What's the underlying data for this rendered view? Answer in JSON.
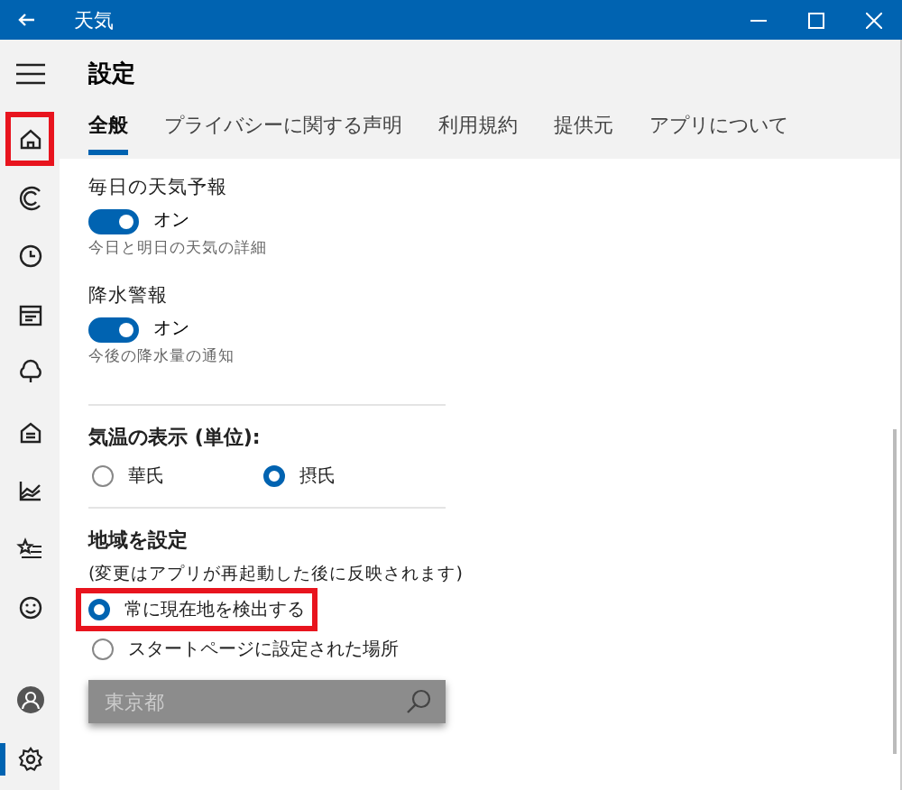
{
  "window": {
    "title": "天気"
  },
  "sidebar": {
    "items": [
      {
        "kind": "home",
        "selected": false,
        "highlighted": true
      },
      {
        "kind": "forecast",
        "selected": false,
        "highlighted": false
      },
      {
        "kind": "clock",
        "selected": false,
        "highlighted": false
      },
      {
        "kind": "calendar",
        "selected": false,
        "highlighted": false
      },
      {
        "kind": "cloud",
        "selected": false,
        "highlighted": false
      },
      {
        "kind": "building",
        "selected": false,
        "highlighted": false
      },
      {
        "kind": "chart",
        "selected": false,
        "highlighted": false
      },
      {
        "kind": "favorites",
        "selected": false,
        "highlighted": false
      },
      {
        "kind": "smile",
        "selected": false,
        "highlighted": false
      }
    ],
    "bottom_items": [
      {
        "kind": "account",
        "selected": false
      },
      {
        "kind": "settings",
        "selected": true
      }
    ]
  },
  "header": {
    "title": "設定"
  },
  "tabs": [
    {
      "label": "全般",
      "selected": true
    },
    {
      "label": "プライバシーに関する声明",
      "selected": false
    },
    {
      "label": "利用規約",
      "selected": false
    },
    {
      "label": "提供元",
      "selected": false
    },
    {
      "label": "アプリについて",
      "selected": false
    }
  ],
  "toggles": [
    {
      "label": "毎日の天気予報",
      "on": true,
      "state_text": "オン",
      "caption": "今日と明日の天気の詳細"
    },
    {
      "label": "降水警報",
      "on": true,
      "state_text": "オン",
      "caption": "今後の降水量の通知"
    }
  ],
  "units": {
    "title": "気温の表示 (単位):",
    "options": [
      {
        "label": "華氏",
        "selected": false
      },
      {
        "label": "摂氏",
        "selected": true
      }
    ]
  },
  "location": {
    "title": "地域を設定",
    "note": "(変更はアプリが再起動した後に反映されます)",
    "options": [
      {
        "label": "常に現在地を検出する",
        "selected": true,
        "highlighted": true
      },
      {
        "label": "スタートページに設定された場所",
        "selected": false,
        "highlighted": false
      }
    ],
    "search": {
      "placeholder": "東京都",
      "disabled": true
    }
  }
}
